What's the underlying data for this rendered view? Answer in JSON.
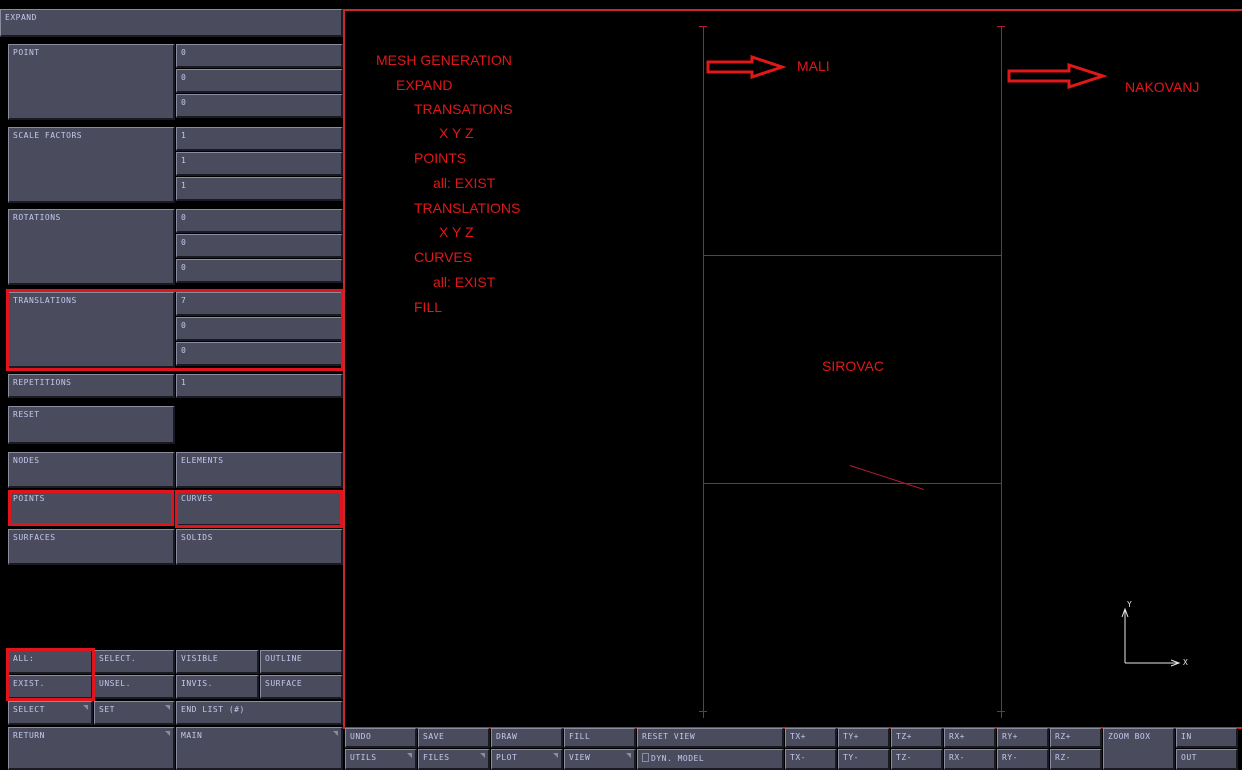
{
  "panel": {
    "title": "EXPAND",
    "point": {
      "label": "POINT",
      "values": [
        "0",
        "0",
        "0"
      ]
    },
    "scale_factors": {
      "label": "SCALE FACTORS",
      "values": [
        "1",
        "1",
        "1"
      ]
    },
    "rotations": {
      "label": "ROTATIONS",
      "values": [
        "0",
        "0",
        "0"
      ]
    },
    "translations": {
      "label": "TRANSLATIONS",
      "values": [
        "7",
        "0",
        "0"
      ]
    },
    "repetitions": {
      "label": "REPETITIONS",
      "value": "1"
    },
    "reset": "RESET",
    "nodes": "NODES",
    "elements": "ELEMENTS",
    "points": "POINTS",
    "curves": "CURVES",
    "surfaces": "SURFACES",
    "solids": "SOLIDS",
    "all": "ALL:",
    "select_dot": "SELECT.",
    "visible": "VISIBLE",
    "outline": "OUTLINE",
    "exist": "EXIST.",
    "unsel": "UNSEL.",
    "invis": "INVIS.",
    "surface": "SURFACE",
    "select": "SELECT",
    "set": "SET",
    "end_list": "END LIST (#)",
    "return": "RETURN",
    "main": "MAIN"
  },
  "annotations": {
    "steps": [
      "MESH GENERATION",
      "EXPAND",
      "TRANSATIONS",
      "X  Y  Z",
      "POINTS",
      "all: EXIST",
      "TRANSLATIONS",
      "X  Y  Z",
      "CURVES",
      "all: EXIST",
      "FILL"
    ],
    "mali": "MALI",
    "nakovanj": "NAKOVANJ",
    "sirovac": "SIROVAC"
  },
  "axes": {
    "y": "Y",
    "x": "X"
  },
  "toolbar": {
    "row1": [
      "UNDO",
      "SAVE",
      "DRAW",
      "FILL",
      "RESET VIEW",
      "TX+",
      "TY+",
      "TZ+",
      "RX+",
      "RY+",
      "RZ+",
      "ZOOM BOX",
      "IN"
    ],
    "row2": [
      "UTILS",
      "FILES",
      "PLOT",
      "VIEW",
      "DYN. MODEL",
      "TX-",
      "TY-",
      "TZ-",
      "RX-",
      "RY-",
      "RZ-",
      "OUT"
    ]
  },
  "colors": {
    "annotation": "#e01818",
    "panel": "#4a4c5e",
    "text": "#c4c8ec",
    "mesh_line": "#b01a3a"
  }
}
